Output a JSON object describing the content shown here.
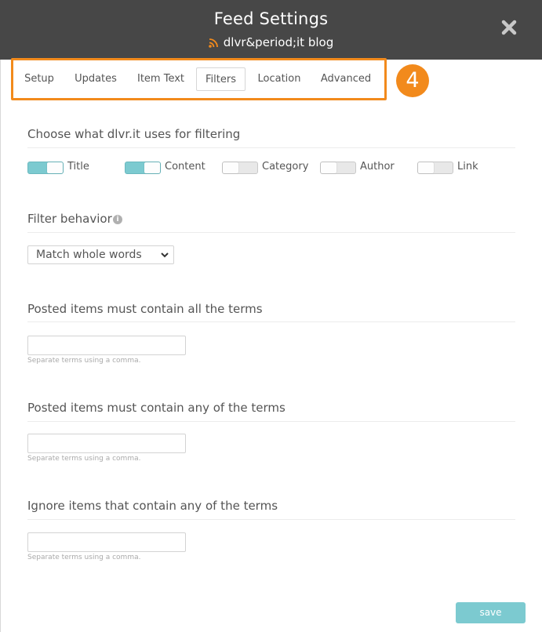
{
  "header": {
    "title": "Feed Settings",
    "subtitle": "dlvr&period;it blog",
    "rss_icon": "rss-icon",
    "close_icon": "close-icon"
  },
  "tabs": [
    {
      "label": "Setup",
      "active": false
    },
    {
      "label": "Updates",
      "active": false
    },
    {
      "label": "Item Text",
      "active": false
    },
    {
      "label": "Filters",
      "active": true
    },
    {
      "label": "Location",
      "active": false
    },
    {
      "label": "Advanced",
      "active": false
    }
  ],
  "step_badge": "4",
  "filtering": {
    "title": "Choose what dlvr.it uses for filtering",
    "options": [
      {
        "label": "Title",
        "on": true
      },
      {
        "label": "Content",
        "on": true
      },
      {
        "label": "Category",
        "on": false
      },
      {
        "label": "Author",
        "on": false
      },
      {
        "label": "Link",
        "on": false
      }
    ]
  },
  "behavior": {
    "title": "Filter behavior",
    "info_icon": "info-icon",
    "selected": "Match whole words"
  },
  "all_terms": {
    "title": "Posted items must contain all the terms",
    "value": "",
    "help": "Separate terms using a comma."
  },
  "any_terms": {
    "title": "Posted items must contain any of the terms",
    "value": "",
    "help": "Separate terms using a comma."
  },
  "ignore_terms": {
    "title": "Ignore items that contain any of the terms",
    "value": "",
    "help": "Separate terms using a comma."
  },
  "save_label": "save",
  "colors": {
    "header_bg": "#474747",
    "accent_orange": "#f28a1c",
    "toggle_on": "#7ccad0",
    "save_button": "#7ccad0"
  }
}
